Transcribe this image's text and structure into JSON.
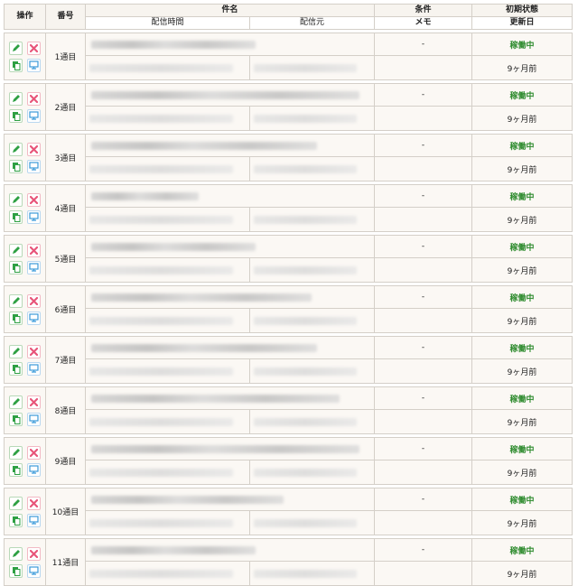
{
  "header": {
    "ops": "操作",
    "num": "番号",
    "subject": "件名",
    "condition": "条件",
    "initial_state": "初期状態",
    "send_time": "配信時間",
    "sender": "配信元",
    "memo": "メモ",
    "updated": "更新日"
  },
  "rows": [
    {
      "num": "1通目",
      "cond": "-",
      "status": "稼働中",
      "updated": "9ヶ月前"
    },
    {
      "num": "2通目",
      "cond": "-",
      "status": "稼働中",
      "updated": "9ヶ月前"
    },
    {
      "num": "3通目",
      "cond": "-",
      "status": "稼働中",
      "updated": "9ヶ月前"
    },
    {
      "num": "4通目",
      "cond": "-",
      "status": "稼働中",
      "updated": "9ヶ月前"
    },
    {
      "num": "5通目",
      "cond": "-",
      "status": "稼働中",
      "updated": "9ヶ月前"
    },
    {
      "num": "6通目",
      "cond": "-",
      "status": "稼働中",
      "updated": "9ヶ月前"
    },
    {
      "num": "7通目",
      "cond": "-",
      "status": "稼働中",
      "updated": "9ヶ月前"
    },
    {
      "num": "8通目",
      "cond": "-",
      "status": "稼働中",
      "updated": "9ヶ月前"
    },
    {
      "num": "9通目",
      "cond": "-",
      "status": "稼働中",
      "updated": "9ヶ月前"
    },
    {
      "num": "10通目",
      "cond": "-",
      "status": "稼働中",
      "updated": "9ヶ月前"
    },
    {
      "num": "11通目",
      "cond": "-",
      "status": "稼働中",
      "updated": "9ヶ月前"
    }
  ],
  "icons": {
    "edit": "pencil-icon",
    "delete": "close-icon",
    "copy": "copy-icon",
    "preview": "monitor-icon"
  },
  "colors": {
    "status": "#2e8b2e",
    "edit": "#2ea043",
    "delete": "#e8557a",
    "preview": "#3b9ad9"
  }
}
